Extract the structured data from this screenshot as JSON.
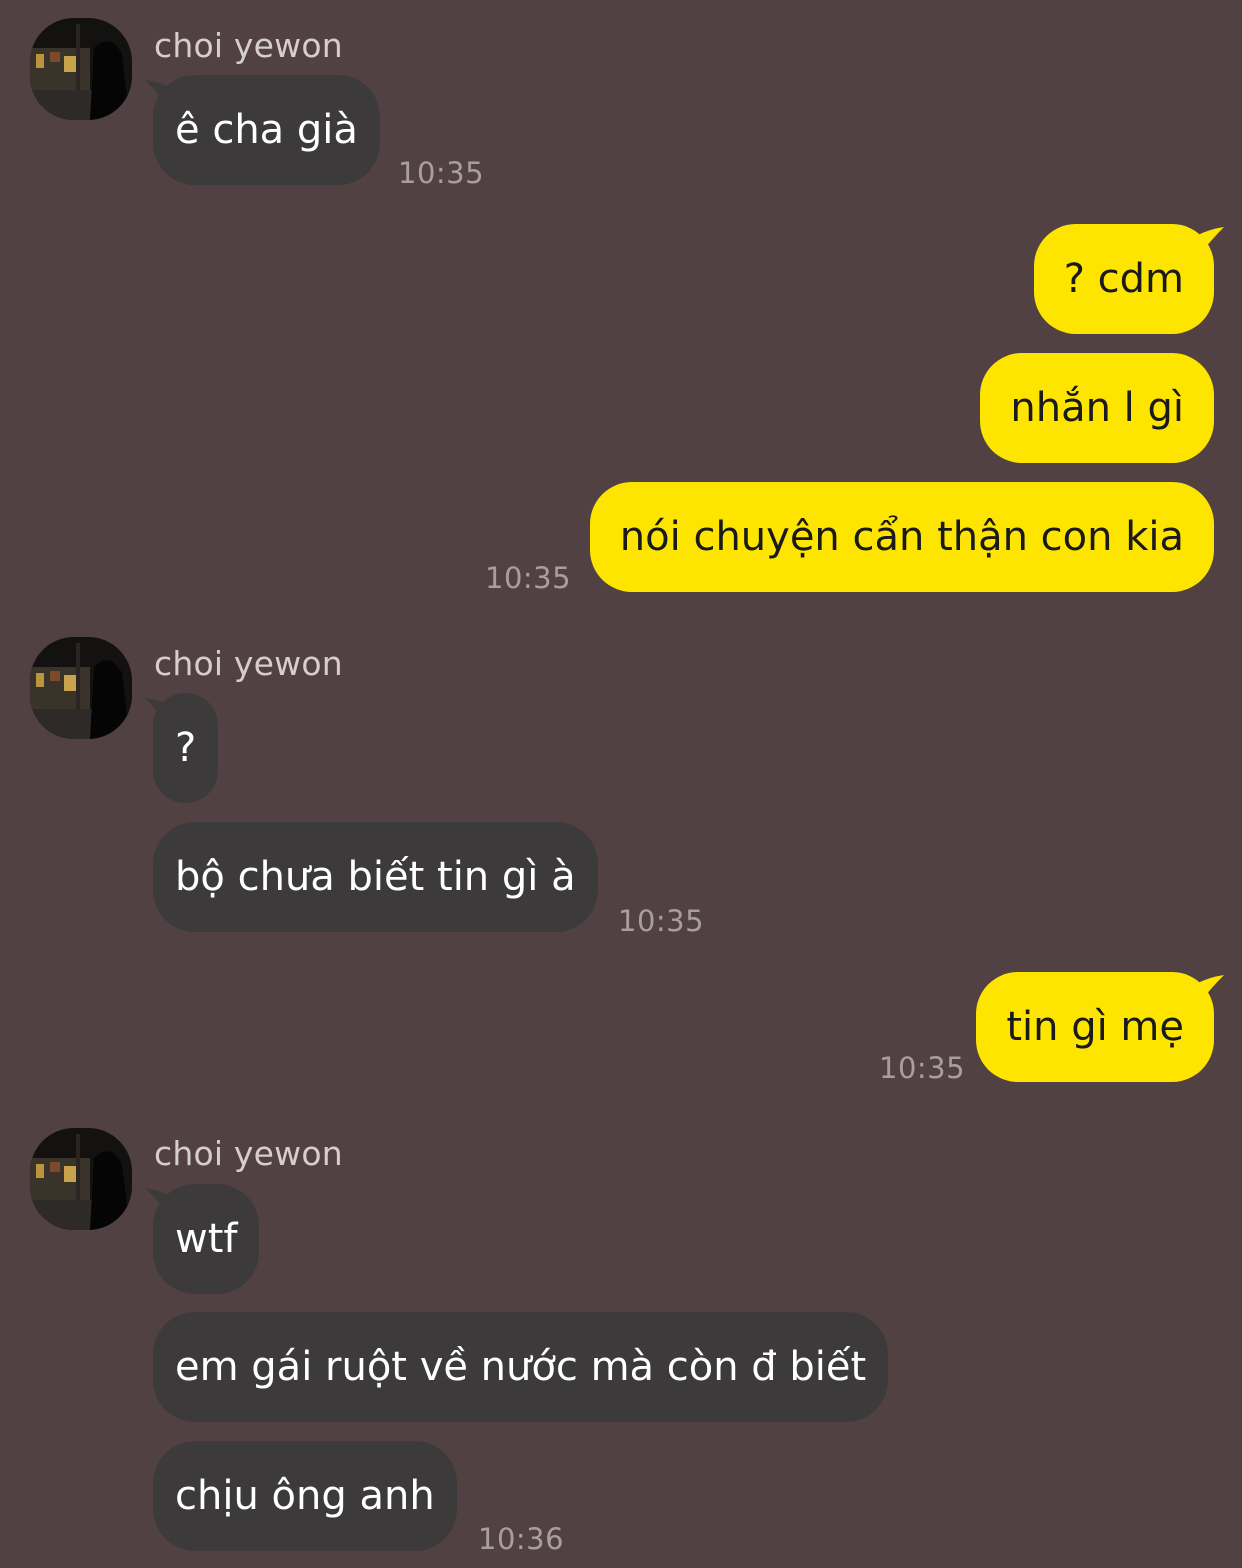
{
  "contact": {
    "name": "choi yewon"
  },
  "colors": {
    "background": "#524142",
    "incoming_bubble": "#3c3a3b",
    "outgoing_bubble": "#fee500"
  },
  "messages": [
    {
      "from": "contact",
      "text": "ê cha già"
    },
    {
      "time": "10:35"
    },
    {
      "from": "me",
      "text": "? cdm"
    },
    {
      "from": "me",
      "text": "nhắn l gì"
    },
    {
      "from": "me",
      "text": "nói chuyện cẩn thận con kia"
    },
    {
      "time": "10:35"
    },
    {
      "from": "contact",
      "text": "?"
    },
    {
      "from": "contact",
      "text": "bộ chưa biết tin gì à"
    },
    {
      "time": "10:35"
    },
    {
      "from": "me",
      "text": "tin gì mẹ"
    },
    {
      "time": "10:35"
    },
    {
      "from": "contact",
      "text": "wtf"
    },
    {
      "from": "contact",
      "text": "em gái ruột về nước mà còn đ biết"
    },
    {
      "from": "contact",
      "text": "chịu ông anh"
    },
    {
      "time": "10:36"
    }
  ]
}
